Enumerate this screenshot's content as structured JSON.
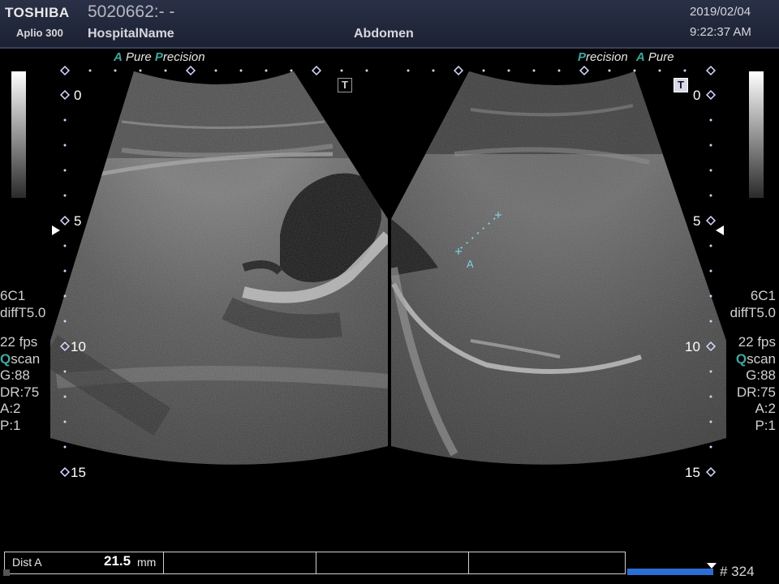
{
  "header": {
    "brand": "TOSHIBA",
    "model": "Aplio 300",
    "patient_id": "5020662:- -",
    "hospital": "HospitalName",
    "preset": "Abdomen",
    "date": "2019/02/04",
    "time": "9:22:37 AM"
  },
  "left_panel": {
    "mode_a": "A",
    "mode_pure": "Pure",
    "mode_p": "P",
    "mode_precision": "recision",
    "depths": [
      "0",
      "5",
      "10",
      "15"
    ],
    "params": {
      "probe": "6C1",
      "filter": "diffT5.0",
      "fps": "22 fps",
      "qscan_q": "Q",
      "qscan_rest": "scan",
      "gain": "G:88",
      "dr": "DR:75",
      "a": "A:2",
      "p": "P:1"
    },
    "t_label": "T"
  },
  "right_panel": {
    "mode_p": "P",
    "mode_precision": "recision",
    "mode_a": "A",
    "mode_pure": "Pure",
    "depths": [
      "0",
      "5",
      "10",
      "15"
    ],
    "params": {
      "probe": "6C1",
      "filter": "diffT5.0",
      "fps": "22 fps",
      "qscan_q": "Q",
      "qscan_rest": "scan",
      "gain": "G:88",
      "dr": "DR:75",
      "a": "A:2",
      "p": "P:1"
    },
    "t_label": "T"
  },
  "caliper": {
    "label": "A"
  },
  "measurement": {
    "name": "Dist A",
    "value": "21.5",
    "unit": "mm"
  },
  "cine": {
    "frame_count": "# 324"
  },
  "colors": {
    "accent_teal": "#3fa6a0",
    "cine_blue": "#2b6fd6",
    "header_bg": "#1c2233"
  }
}
